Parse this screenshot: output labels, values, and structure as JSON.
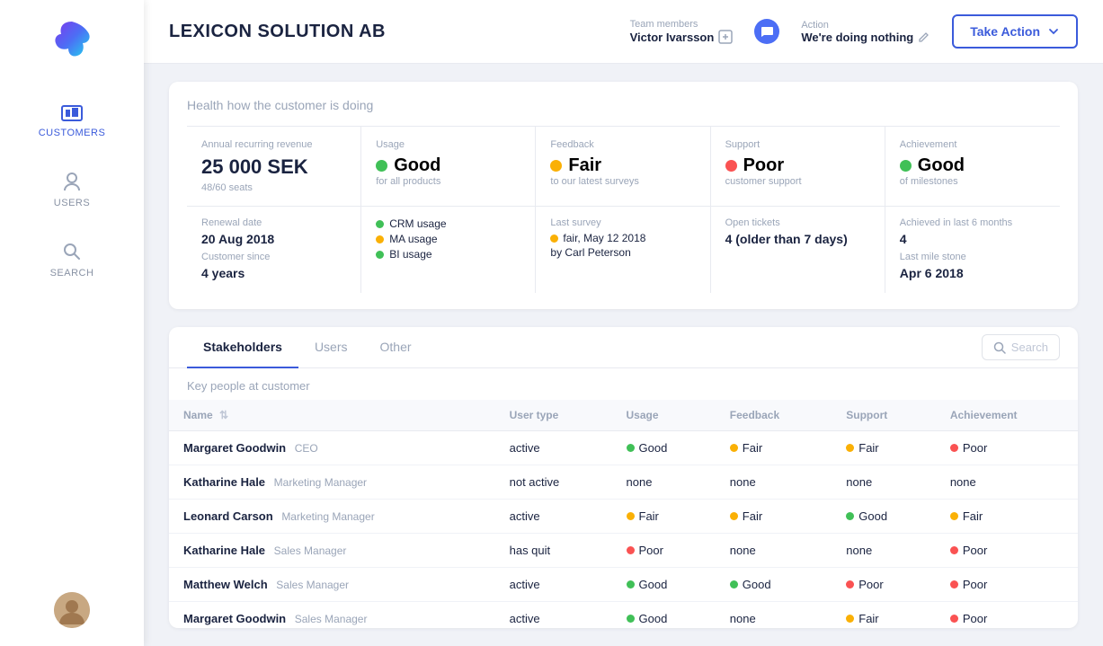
{
  "sidebar": {
    "logo_bg": "#4c6ef5",
    "items": [
      {
        "id": "customers",
        "label": "CUSTOMERS",
        "active": true
      },
      {
        "id": "users",
        "label": "USERS",
        "active": false
      },
      {
        "id": "search",
        "label": "SEARCH",
        "active": false
      }
    ]
  },
  "header": {
    "company": "LEXICON SOLUTION AB",
    "team_members_label": "Team members",
    "team_members_value": "Victor Ivarsson",
    "action_label": "Action",
    "action_value": "We're doing nothing",
    "take_action_btn": "Take Action"
  },
  "health": {
    "section_label": "Health",
    "section_sub": "how the customer is doing",
    "cards": [
      {
        "label": "Annual recurring revenue",
        "value": "25 000 SEK",
        "sub": "48/60 seats",
        "type": "text",
        "detail_label": "Renewal date",
        "detail_value": "20 Aug 2018",
        "detail2_label": "Customer since",
        "detail2_value": "4 years"
      },
      {
        "label": "Usage",
        "value": "Good",
        "sub": "for all products",
        "status": "green",
        "type": "status",
        "detail_items": [
          {
            "label": "CRM usage",
            "color": "green"
          },
          {
            "label": "MA usage",
            "color": "yellow"
          },
          {
            "label": "BI usage",
            "color": "green"
          }
        ]
      },
      {
        "label": "Feedback",
        "value": "Fair",
        "sub": "to our latest surveys",
        "status": "yellow",
        "type": "status",
        "detail_label": "Last survey",
        "detail_survey": "fair, May 12 2018",
        "detail_survey_color": "yellow",
        "detail_by": "by Carl Peterson"
      },
      {
        "label": "Support",
        "value": "Poor",
        "sub": "customer support",
        "status": "red",
        "type": "status",
        "detail_label": "Open tickets",
        "detail_value": "4 (older than 7 days)"
      },
      {
        "label": "Achievement",
        "value": "Good",
        "sub": "of milestones",
        "status": "green",
        "type": "status",
        "detail_label": "Achieved in last 6 months",
        "detail_value": "4",
        "detail2_label": "Last mile stone",
        "detail2_value": "Apr 6 2018"
      }
    ]
  },
  "tabs": {
    "items": [
      {
        "label": "Stakeholders",
        "active": true
      },
      {
        "label": "Users",
        "active": false
      },
      {
        "label": "Other",
        "active": false
      }
    ],
    "search_placeholder": "Search",
    "section_label": "Key people at customer"
  },
  "table": {
    "columns": [
      "Name",
      "User type",
      "Usage",
      "Feedback",
      "Support",
      "Achievement"
    ],
    "rows": [
      {
        "name": "Margaret Goodwin",
        "role": "CEO",
        "user_type": "active",
        "usage": {
          "label": "Good",
          "color": "green"
        },
        "feedback": {
          "label": "Fair",
          "color": "yellow"
        },
        "support": {
          "label": "Fair",
          "color": "yellow"
        },
        "achievement": {
          "label": "Poor",
          "color": "red"
        }
      },
      {
        "name": "Katharine Hale",
        "role": "Marketing Manager",
        "user_type": "not active",
        "usage": {
          "label": "none",
          "color": ""
        },
        "feedback": {
          "label": "none",
          "color": ""
        },
        "support": {
          "label": "none",
          "color": ""
        },
        "achievement": {
          "label": "none",
          "color": ""
        }
      },
      {
        "name": "Leonard Carson",
        "role": "Marketing Manager",
        "user_type": "active",
        "usage": {
          "label": "Fair",
          "color": "yellow"
        },
        "feedback": {
          "label": "Fair",
          "color": "yellow"
        },
        "support": {
          "label": "Good",
          "color": "green"
        },
        "achievement": {
          "label": "Fair",
          "color": "yellow"
        }
      },
      {
        "name": "Katharine Hale",
        "role": "Sales Manager",
        "user_type": "has quit",
        "usage": {
          "label": "Poor",
          "color": "red"
        },
        "feedback": {
          "label": "none",
          "color": ""
        },
        "support": {
          "label": "none",
          "color": ""
        },
        "achievement": {
          "label": "Poor",
          "color": "red"
        }
      },
      {
        "name": "Matthew Welch",
        "role": "Sales Manager",
        "user_type": "active",
        "usage": {
          "label": "Good",
          "color": "green"
        },
        "feedback": {
          "label": "Good",
          "color": "green"
        },
        "support": {
          "label": "Poor",
          "color": "red"
        },
        "achievement": {
          "label": "Poor",
          "color": "red"
        }
      },
      {
        "name": "Margaret Goodwin",
        "role": "Sales Manager",
        "user_type": "active",
        "usage": {
          "label": "Good",
          "color": "green"
        },
        "feedback": {
          "label": "none",
          "color": ""
        },
        "support": {
          "label": "Fair",
          "color": "yellow"
        },
        "achievement": {
          "label": "Poor",
          "color": "red"
        }
      }
    ]
  }
}
